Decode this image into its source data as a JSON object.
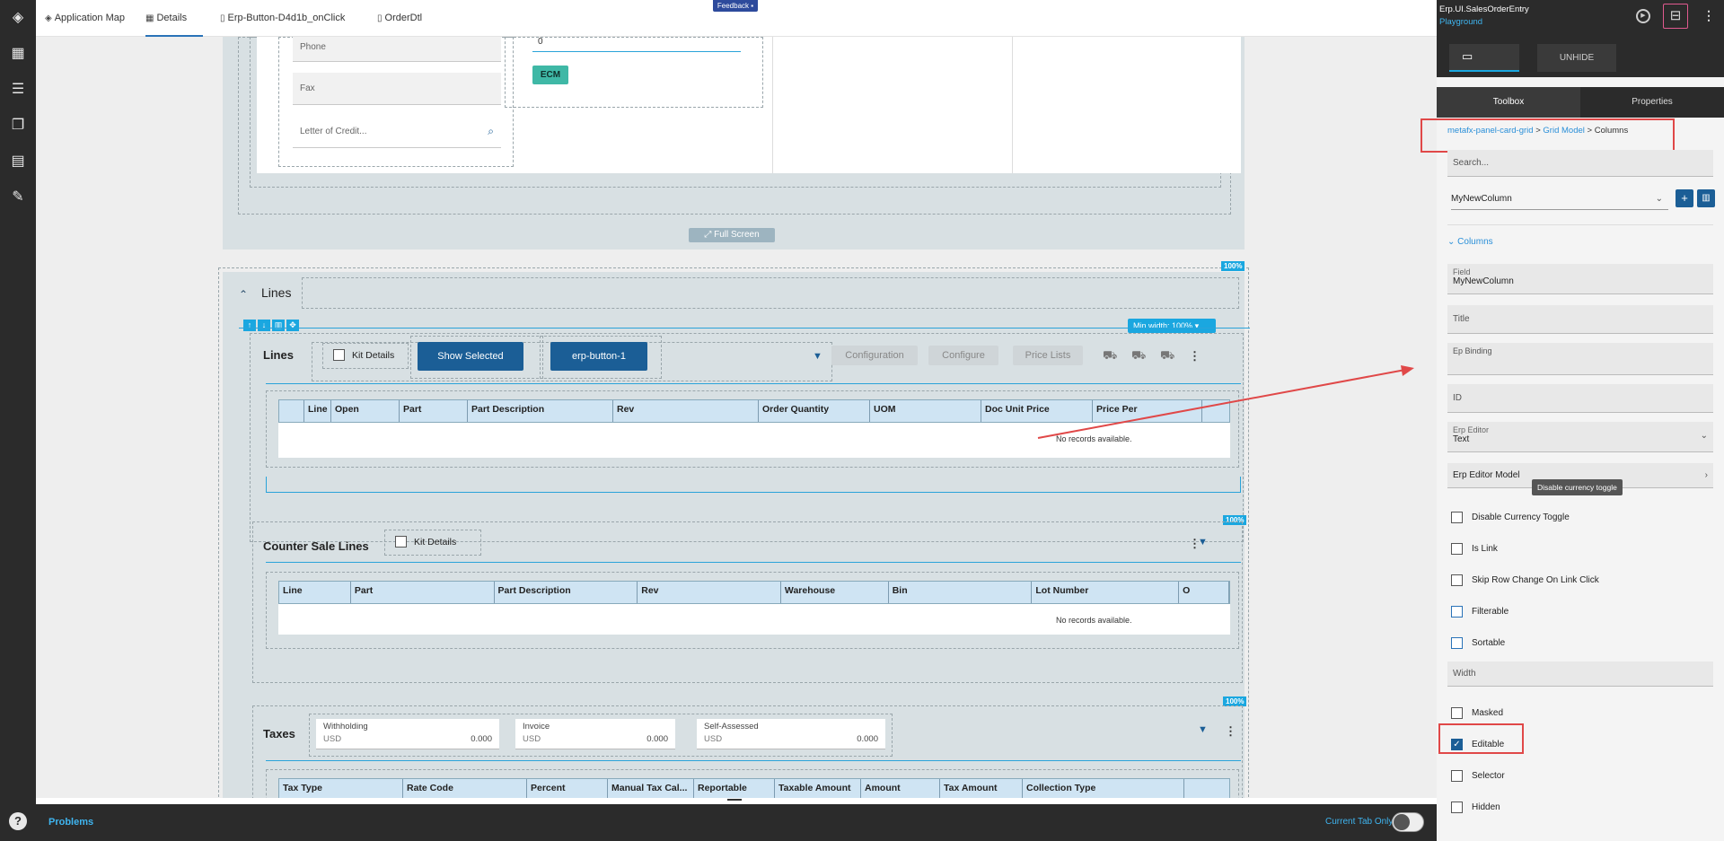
{
  "tabs": [
    {
      "icon": "cube-icon",
      "label": "Application Map"
    },
    {
      "icon": "grid-icon",
      "label": "Details"
    },
    {
      "icon": "",
      "label": "Erp-Button-D4d1b_onClick"
    },
    {
      "icon": "doc-icon",
      "label": "OrderDtl"
    }
  ],
  "feedback_label": "Feedback",
  "top_section": {
    "phone": "Phone",
    "fax": "Fax",
    "letter_of_credit": "Letter of Credit...",
    "num_value": "0",
    "ecm_label": "ECM",
    "full_screen": "Full Screen"
  },
  "lines": {
    "header": "Lines",
    "percent": "100%",
    "min_width": "Min width: 100%",
    "title": "Lines",
    "kit_details": "Kit Details",
    "show_selected": "Show Selected",
    "erp_button": "erp-button-1",
    "configuration": "Configuration",
    "configure": "Configure",
    "price_lists": "Price Lists",
    "columns": [
      "Line",
      "Open",
      "Part",
      "Part Description",
      "Rev",
      "Order Quantity",
      "UOM",
      "Doc Unit Price",
      "Price Per"
    ],
    "no_records": "No records available."
  },
  "counter": {
    "percent": "100%",
    "title": "Counter Sale Lines",
    "kit_details": "Kit Details",
    "columns": [
      "Line",
      "Part",
      "Part Description",
      "Rev",
      "Warehouse",
      "Bin",
      "Lot Number",
      "O"
    ],
    "no_records": "No records available."
  },
  "taxes": {
    "percent": "100%",
    "title": "Taxes",
    "withholding": {
      "label": "Withholding",
      "currency": "USD",
      "value": "0.000"
    },
    "invoice": {
      "label": "Invoice",
      "currency": "USD",
      "value": "0.000"
    },
    "self_assessed": {
      "label": "Self-Assessed",
      "currency": "USD",
      "value": "0.000"
    },
    "columns": [
      "Tax Type",
      "Rate Code",
      "Percent",
      "Manual Tax Cal...",
      "Reportable",
      "Taxable Amount",
      "Amount",
      "Tax Amount",
      "Collection Type"
    ]
  },
  "bottom": {
    "problems": "Problems",
    "current_tab_only": "Current Tab Only"
  },
  "right": {
    "app_name": "Erp.UI.SalesOrderEntry",
    "env": "Playground",
    "unhide": "UNHIDE",
    "toolbox": "Toolbox",
    "properties": "Properties",
    "breadcrumb": [
      "metafx-panel-card-grid",
      "Grid Model",
      "Columns"
    ],
    "search_placeholder": "Search...",
    "selected_column": "MyNewColumn",
    "columns_section": "Columns",
    "field_label": "Field",
    "field_value": "MyNewColumn",
    "title_label": "Title",
    "ep_binding_label": "Ep Binding",
    "id_label": "ID",
    "erp_editor_label": "Erp Editor",
    "erp_editor_value": "Text",
    "erp_editor_model": "Erp Editor Model",
    "tooltip": "Disable currency toggle",
    "width_label": "Width",
    "checkboxes": [
      {
        "label": "Disable Currency Toggle",
        "checked": false
      },
      {
        "label": "Is Link",
        "checked": false
      },
      {
        "label": "Skip Row Change On Link Click",
        "checked": false
      },
      {
        "label": "Filterable",
        "checked": false
      },
      {
        "label": "Sortable",
        "checked": false
      },
      {
        "label": "Masked",
        "checked": false
      },
      {
        "label": "Editable",
        "checked": true
      },
      {
        "label": "Selector",
        "checked": false
      },
      {
        "label": "Hidden",
        "checked": false
      }
    ]
  },
  "colors": {
    "accent": "#1aa7e0",
    "dark": "#2b2b2b",
    "button": "#1b5e96",
    "annotation": "#e04848"
  }
}
